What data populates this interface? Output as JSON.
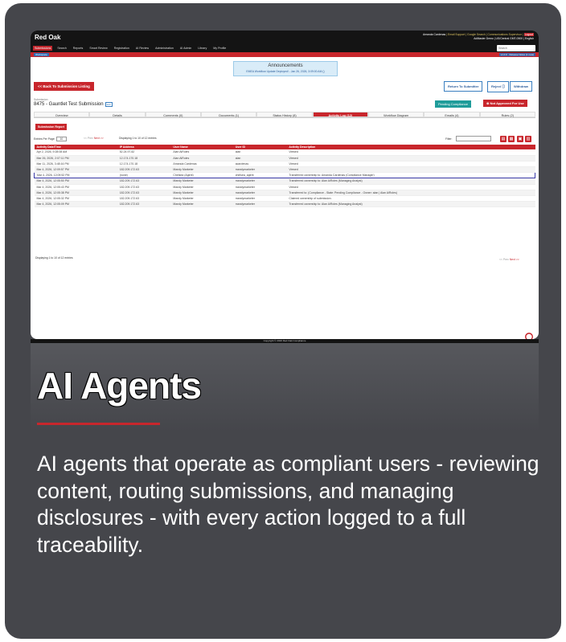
{
  "app": {
    "logo": "Red Oak",
    "user_info_line1_name": "Amanda Cardenas",
    "user_info_links": "| Email Support | Google Search | Communications Supervisor |",
    "logout": "Logout",
    "user_info_line2": "AdMaster Demo | US/Central GMT-0500 | English",
    "search_placeholder": "Search",
    "nav": [
      "Submissions",
      "Search",
      "Reports",
      "Smart Review",
      "Registration",
      "AI Review",
      "Administration",
      "AI Admin",
      "Library",
      "My Profile"
    ],
    "sub_tag": "Workspace",
    "release_notes": "v1.0.0 · Release Notes (1 new)"
  },
  "announcement": {
    "title": "Announcements",
    "text": "EMEA Workflow Update Deployed! - Jan 26, 2026, 3:09:00 AM ()"
  },
  "actions": {
    "back": "<< Back To Submission Listing",
    "return_to_submitter": "Return To Submitter",
    "reject": "Reject ⓘ",
    "withdraw": "Withdraw",
    "pending_compliance": "Pending Compliance",
    "not_approved": "⊗ Not Approved For Use"
  },
  "submission": {
    "label": "Submission",
    "title": "8475 - Gauntlet Test Submission",
    "badge": "Edit"
  },
  "tabs": [
    "Overview",
    "Details",
    "Comments (0)",
    "Documents (1)",
    "Status History (8)",
    "Activity Log (12)",
    "Workflow Diagram",
    "Emails (4)",
    "Rules (2)"
  ],
  "log": {
    "report_button": "Submission Report",
    "entries_per_page": "Entries Per Page:",
    "per_page_value": "10",
    "prev": "<< Prev",
    "next": "Next >>",
    "displaying_top": "Displaying 1 to 10 of 12 entries",
    "filter_label": "Filter:",
    "columns": [
      "Activity Date/Time",
      "IP Address",
      "User Name",
      "User ID",
      "Activity Description"
    ],
    "rows": [
      [
        "Apr 2, 2026, 9:28:08 AM",
        "52.24.97.82",
        "Alan AiRoles",
        "alan",
        "Viewed"
      ],
      [
        "Mar 26, 2026, 2:07:11 PM",
        "12.174.170.18",
        "Alan AiRoles",
        "alan",
        "Viewed"
      ],
      [
        "Mar 11, 2026, 3:48:16 PM",
        "12.174.170.18",
        "Amanda Cardenas",
        "acardenas",
        "Viewed"
      ],
      [
        "Mar 4, 2026, 12:09:57 PM",
        "182.209.172.63",
        "Mandy Marketer",
        "mandymarketer",
        "Viewed"
      ],
      [
        "Mar 4, 2026, 12:09:52 PM",
        "(none)",
        "Chelsea (Agent)",
        "chelsea_agent",
        "Transferred ownership to: Amanda Cardenas (Compliance Manager)"
      ],
      [
        "Mar 4, 2026, 12:05:50 PM",
        "182.209.172.63",
        "Mandy Marketer",
        "mandymarketer",
        "Transferred ownership to: Alan AiRoles (Managing Analyst)"
      ],
      [
        "Mar 4, 2026, 12:05:43 PM",
        "182.209.172.63",
        "Mandy Marketer",
        "mandymarketer",
        "Viewed"
      ],
      [
        "Mar 4, 2026, 12:05:38 PM",
        "182.209.172.63",
        "Mandy Marketer",
        "mandymarketer",
        "Transferred to: (Compliance - State: Pending Compliance - Owner: alan | Alan AiRoles)"
      ],
      [
        "Mar 4, 2026, 12:05:32 PM",
        "182.209.172.63",
        "Mandy Marketer",
        "mandymarketer",
        "Claimed ownership of submission."
      ],
      [
        "Mar 4, 2026, 12:05:09 PM",
        "182.209.172.63",
        "Mandy Marketer",
        "mandymarketer",
        "Transferred ownership to: Alan AiRoles (Managing Analyst)"
      ]
    ],
    "displaying_bottom": "Displaying 1 to 10 of 12 entries"
  },
  "footer": "Copyright © 2026 Red Oak Compliance",
  "headline": "AI Agents",
  "description": "AI agents that operate as compliant users - reviewing content, routing submissions, and managing disclosures - with every action logged to a full traceability.",
  "colors": {
    "accent": "#c8262c",
    "card_bg": "#45464b",
    "nav_bg": "#141414"
  }
}
